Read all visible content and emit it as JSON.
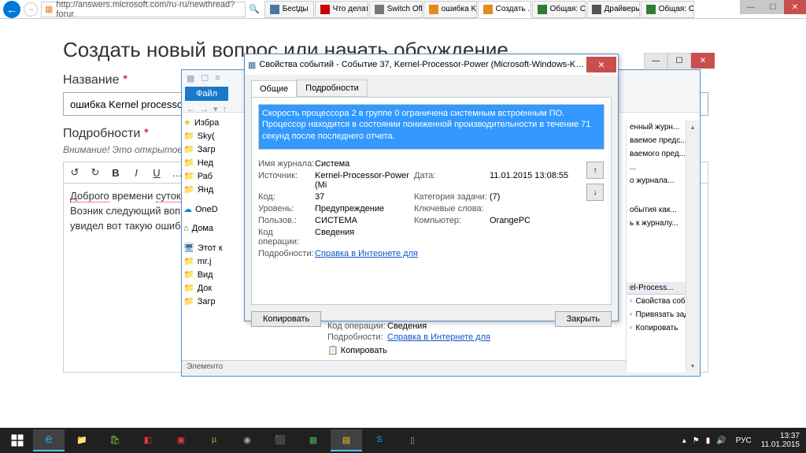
{
  "window_controls": {
    "min": "—",
    "max": "☐",
    "close": "✕"
  },
  "ie": {
    "url": "http://answers.microsoft.com/ru-ru/newthread?forur",
    "search_glyph": "🔍",
    "tabs": [
      {
        "label": "Бесtды",
        "favcolor": "#4a76a8"
      },
      {
        "label": "Что делать ...",
        "favcolor": "#cc0000"
      },
      {
        "label": "Switch Off с...",
        "favcolor": "#777"
      },
      {
        "label": "ошибка Ker...",
        "favcolor": "#e38b1e"
      },
      {
        "label": "Создать ...",
        "favcolor": "#e38b1e",
        "active": true,
        "close": "✕"
      },
      {
        "label": "Общая: On...",
        "favcolor": "#2e7d32"
      },
      {
        "label": "Драйверы ...",
        "favcolor": "#555"
      },
      {
        "label": "Общая: On...",
        "favcolor": "#2e7d32"
      }
    ],
    "home_glyph": "⌂",
    "star_glyph": "★",
    "gear_glyph": "⚙"
  },
  "page": {
    "title": "Создать новый вопрос или начать обсуждение",
    "label_title": "Название",
    "input_title_value": "ошибка Kernel processor р",
    "label_details": "Подробности",
    "note": "Внимание! Это открытое сообщество. Не публикуйте ваши личные данные (адрес электронной почты, номер",
    "editor": {
      "undo": "↺",
      "redo": "↻",
      "bold": "B",
      "italic": "I",
      "underline": "U",
      "more": "…"
    },
    "body_line1_a": "Доброго",
    "body_line1_b": " времени ",
    "body_line1_c": "суток",
    "body_line1_d": "!",
    "body_line2": "Возник следующий вопрос",
    "body_line3": "увидел вот такую ошибку"
  },
  "explorer": {
    "file_tab": "Файл",
    "back": "←",
    "fwd": "→",
    "up": "↑",
    "sidebar": {
      "fav": "Избра",
      "items1": [
        "Sky(",
        "Загр",
        "Нед",
        "Раб",
        "Янд"
      ],
      "onedrive": "OneD",
      "home": "Дома",
      "thispc": "Этот к",
      "items2": [
        "mr.j",
        "Вид",
        "Док",
        "Загр"
      ]
    },
    "statusbar": "Элементо",
    "right": {
      "items_top": [
        "енный журн...",
        "ваемое предс...",
        "ваемого пред...",
        "...",
        "о журнала..."
      ],
      "items_mid": [
        "обытия как...",
        "ь к журналу..."
      ],
      "hdr2": "el-Process...",
      "items_bot": [
        "Свойства событий",
        "Привязать задачу к событию...",
        "Копировать"
      ]
    },
    "copy_icon": "📋",
    "bottom": {
      "k1": "Код операции:",
      "v1": "Сведения",
      "k2": "Подробности:",
      "v2": "Справка в Интернете для"
    }
  },
  "dialog": {
    "title": "Свойства событий - Событие 37, Kernel-Processor-Power (Microsoft-Windows-Ker...",
    "close": "✕",
    "tabs": {
      "general": "Общие",
      "details": "Подробности"
    },
    "message": "Скорость процессора 2 в группе 0 ограничена системным встроенным ПО. Процессор находится в состоянии пониженной производительности в течение 71 секунд после последнего отчета.",
    "rows": {
      "log_name_k": "Имя журнала:",
      "log_name_v": "Система",
      "source_k": "Источник:",
      "source_v": "Kernel-Processor-Power (Mi",
      "date_k": "Дата:",
      "date_v": "11.01.2015 13:08:55",
      "code_k": "Код:",
      "code_v": "37",
      "cat_k": "Категория задачи:",
      "cat_v": "(7)",
      "level_k": "Уровень:",
      "level_v": "Предупреждение",
      "keywords_k": "Ключевые слова:",
      "keywords_v": "",
      "user_k": "Пользов.:",
      "user_v": "СИСТЕМА",
      "computer_k": "Компьютер:",
      "computer_v": "OrangePC",
      "opcode_k": "Код операции:",
      "opcode_v": "Сведения",
      "details_k": "Подробности:",
      "details_v": "Справка в Интернете для"
    },
    "copy_btn": "Копировать",
    "close_btn": "Закрыть",
    "up": "↑",
    "down": "↓"
  },
  "taskbar": {
    "tray": {
      "up": "▴",
      "flag": "⚑",
      "net": "▮",
      "vol": "🔊",
      "lang": "РУС",
      "time": "13:37",
      "date": "11.01.2015"
    }
  }
}
